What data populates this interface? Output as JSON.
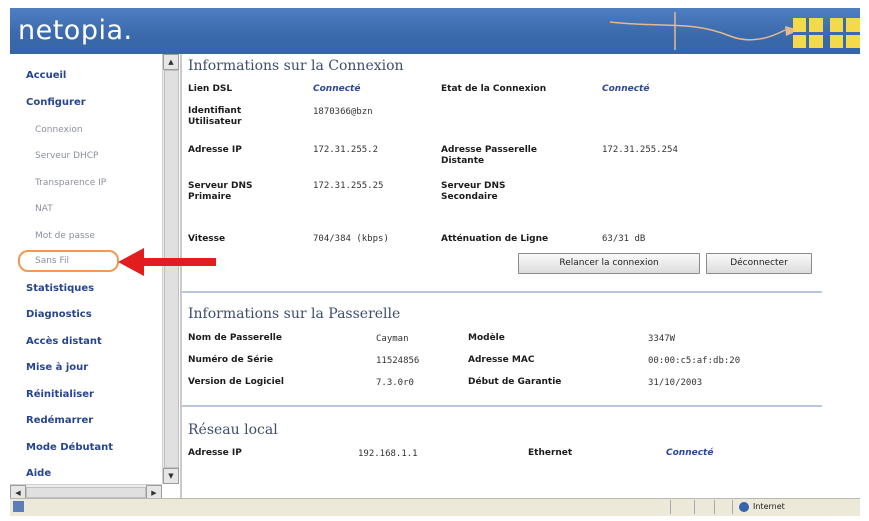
{
  "brand": {
    "logo_text": "netopia.",
    "header_color": "#3b6aad",
    "tile_color": "#f4d94a"
  },
  "sidebar": {
    "items": [
      {
        "label": "Accueil",
        "level": "main"
      },
      {
        "label": "Configurer",
        "level": "main"
      },
      {
        "label": "Connexion",
        "level": "sub"
      },
      {
        "label": "Serveur DHCP",
        "level": "sub"
      },
      {
        "label": "Transparence IP",
        "level": "sub"
      },
      {
        "label": "NAT",
        "level": "sub"
      },
      {
        "label": "Mot de passe",
        "level": "sub"
      },
      {
        "label": "Sans Fil",
        "level": "sub",
        "highlighted": true
      },
      {
        "label": "Statistiques",
        "level": "main"
      },
      {
        "label": "Diagnostics",
        "level": "main"
      },
      {
        "label": "Accès distant",
        "level": "main"
      },
      {
        "label": "Mise à jour",
        "level": "main"
      },
      {
        "label": "Réinitialiser",
        "level": "main"
      },
      {
        "label": "Redémarrer",
        "level": "main"
      },
      {
        "label": "Mode Débutant",
        "level": "main"
      },
      {
        "label": "Aide",
        "level": "main"
      }
    ]
  },
  "connection": {
    "title": "Informations sur la Connexion",
    "dsl_line_label": "Lien DSL",
    "dsl_line_value": "Connecté",
    "state_label": "Etat de la Connexion",
    "state_value": "Connecté",
    "user_id_label": "Identifiant Utilisateur",
    "user_id_value": "1870366@bzn",
    "ip_label": "Adresse IP",
    "ip_value": "172.31.255.2",
    "gateway_label": "Adresse Passerelle Distante",
    "gateway_value": "172.31.255.254",
    "dns1_label": "Serveur DNS Primaire",
    "dns1_value": "172.31.255.25",
    "dns2_label": "Serveur DNS Secondaire",
    "dns2_value": "",
    "speed_label": "Vitesse",
    "speed_value": "704/384 (kbps)",
    "attenuation_label": "Atténuation de Ligne",
    "attenuation_value": "63/31 dB",
    "restart_button": "Relancer la connexion",
    "disconnect_button": "Déconnecter"
  },
  "gateway": {
    "title": "Informations sur la Passerelle",
    "name_label": "Nom de Passerelle",
    "name_value": "Cayman",
    "model_label": "Modèle",
    "model_value": "3347W",
    "serial_label": "Numéro de Série",
    "serial_value": "11524856",
    "mac_label": "Adresse MAC",
    "mac_value": "00:00:c5:af:db:20",
    "software_label": "Version de Logiciel",
    "software_value": "7.3.0r0",
    "warranty_label": "Début de Garantie",
    "warranty_value": "31/10/2003"
  },
  "lan": {
    "title": "Réseau local",
    "ip_label": "Adresse IP",
    "ip_value": "192.168.1.1",
    "ethernet_label": "Ethernet",
    "ethernet_value": "Connecté"
  },
  "statusbar": {
    "zone_text": "Internet"
  }
}
